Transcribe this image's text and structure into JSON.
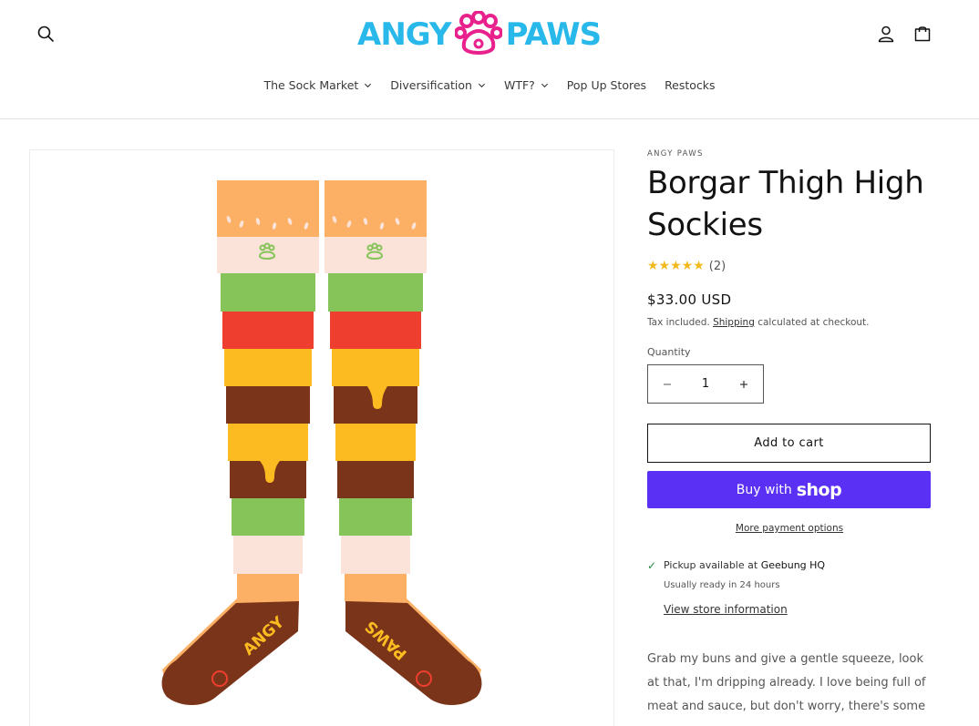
{
  "header": {
    "logo_left": "ANGY",
    "logo_right": "PAWS",
    "nav": [
      {
        "label": "The Sock Market",
        "dropdown": true
      },
      {
        "label": "Diversification",
        "dropdown": true
      },
      {
        "label": "WTF?",
        "dropdown": true
      },
      {
        "label": "Pop Up Stores",
        "dropdown": false
      },
      {
        "label": "Restocks",
        "dropdown": false
      }
    ],
    "icons": [
      "search-icon",
      "account-icon",
      "cart-icon"
    ]
  },
  "product": {
    "vendor": "ANGY PAWS",
    "title": "Borgar Thigh High Sockies",
    "rating_stars": 5,
    "rating_count": "(2)",
    "price": "$33.00 USD",
    "tax_prefix": "Tax included.",
    "tax_link": "Shipping",
    "tax_suffix": "calculated at checkout.",
    "quantity_label": "Quantity",
    "quantity_value": "1",
    "add_to_cart": "Add to cart",
    "buy_with": "Buy with",
    "shop_word": "shop",
    "more_payment": "More payment options",
    "pickup_prefix": "Pickup available at",
    "pickup_location": "Geebung HQ",
    "ready_text": "Usually ready in 24 hours",
    "store_info": "View store information",
    "description": "Grab my buns and give a gentle squeeze, look at that, I'm dripping already.  I love being full of meat and sauce, but don't worry, there's some"
  },
  "colors": {
    "logo_blue": "#29b8ea",
    "logo_pink": "#e8218c",
    "shop_purple": "#5a31f4",
    "star": "#f2b91c",
    "bun": "#fbb065",
    "cream": "#fbe3da",
    "lettuce": "#86c45a",
    "tomato": "#ee3e2f",
    "cheese": "#fbbb21",
    "patty": "#7a3419",
    "pickup_check": "#238b45"
  }
}
